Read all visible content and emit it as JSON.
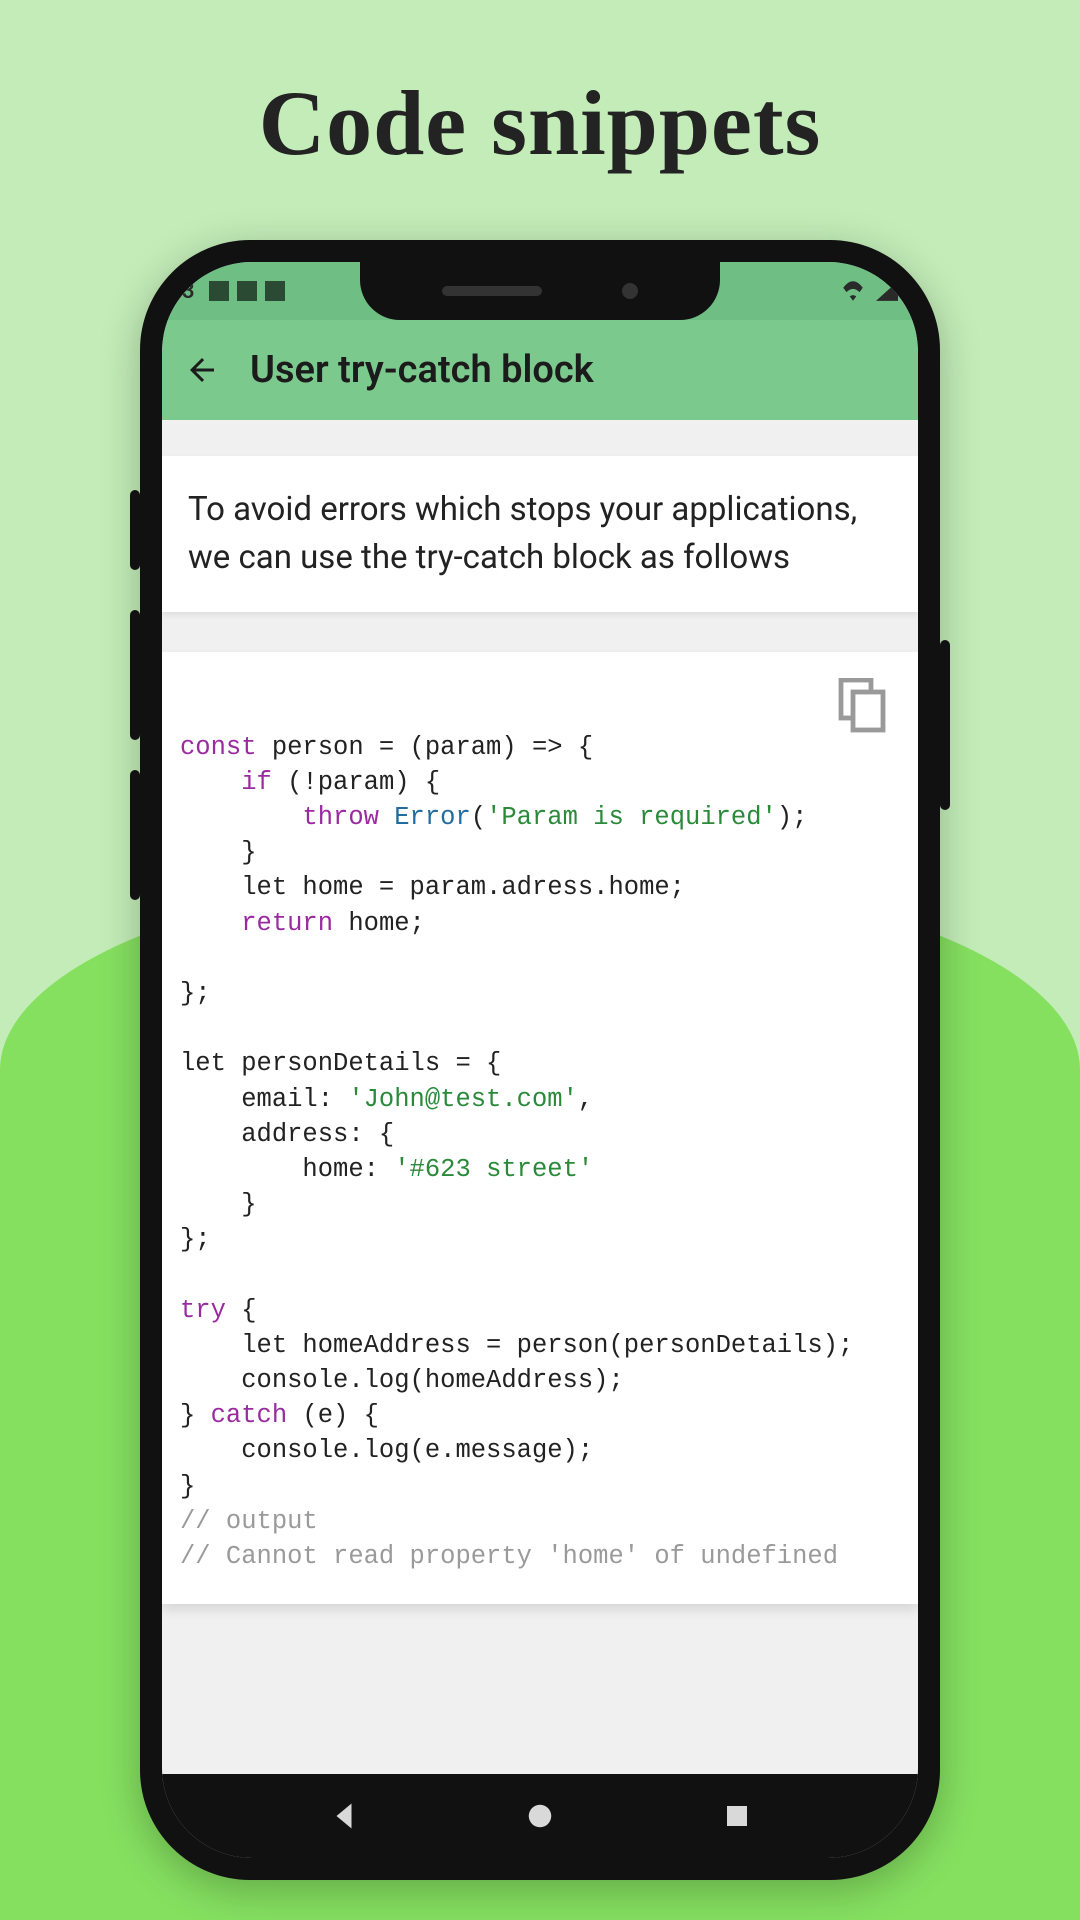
{
  "page_heading": "Code snippets",
  "statusbar": {
    "time": "3"
  },
  "appbar": {
    "title": "User try-catch block"
  },
  "description": "To avoid errors which stops your applications, we can use the try-catch block as follows",
  "code_tokens": [
    [
      "kw",
      "const"
    ],
    [
      "",
      " person = (param) => {\n    "
    ],
    [
      "kw",
      "if"
    ],
    [
      "",
      " (!param) {\n        "
    ],
    [
      "kw",
      "throw"
    ],
    [
      "",
      " "
    ],
    [
      "cls",
      "Error"
    ],
    [
      "",
      "("
    ],
    [
      "str",
      "'Param is required'"
    ],
    [
      "",
      ");\n    }\n    let home = param.adress.home;\n    "
    ],
    [
      "kw",
      "return"
    ],
    [
      "",
      " home;\n\n};\n\nlet personDetails = {\n    email: "
    ],
    [
      "str",
      "'John@test.com'"
    ],
    [
      "",
      ",\n    address: {\n        home: "
    ],
    [
      "str",
      "'#623 street'"
    ],
    [
      "",
      "\n    }\n};\n\n"
    ],
    [
      "kw",
      "try"
    ],
    [
      "",
      " {\n    let homeAddress = person(personDetails);\n    console.log(homeAddress);\n} "
    ],
    [
      "kw",
      "catch"
    ],
    [
      "",
      " (e) {\n    console.log(e.message);\n}\n"
    ],
    [
      "com",
      "// output"
    ],
    [
      "",
      "\n"
    ],
    [
      "com",
      "// Cannot read property 'home' of undefined"
    ]
  ],
  "colors": {
    "bg_light": "#c3ecb8",
    "bg_dark": "#85e060",
    "appbar": "#7cc98e",
    "statusbar": "#6fbf85"
  }
}
